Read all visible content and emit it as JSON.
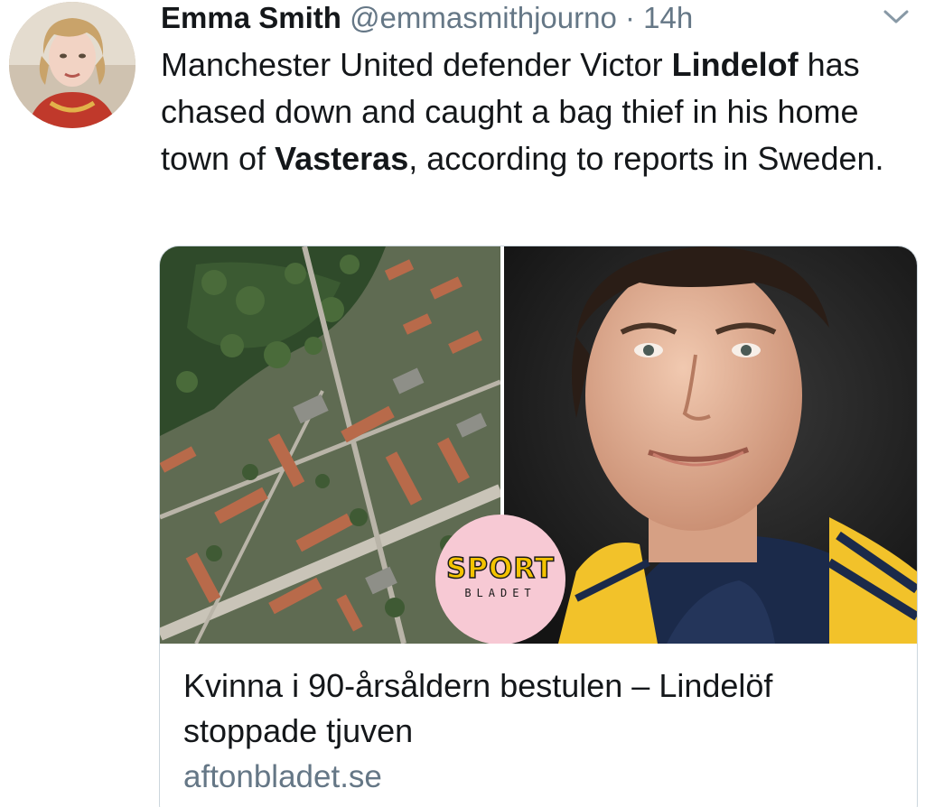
{
  "author": {
    "name": "Emma Smith",
    "handle": "@emmasmithjourno",
    "separator": "·",
    "time": "14h"
  },
  "tweet": {
    "segments": [
      {
        "text": "Manchester United defender Victor ",
        "bold": false
      },
      {
        "text": "Lindelof",
        "bold": true
      },
      {
        "text": " has chased down and caught a bag thief in his home town of ",
        "bold": false
      },
      {
        "text": "Vasteras",
        "bold": true
      },
      {
        "text": ", according to reports in Sweden.",
        "bold": false
      }
    ]
  },
  "card": {
    "logo": {
      "line1": "SPORT",
      "line2": "BLADET"
    },
    "title": "Kvinna i 90-årsåldern bestulen – Lindelöf stoppade tjuven",
    "domain": "aftonbladet.se"
  },
  "icons": {
    "menu": "chevron-down-icon"
  },
  "colors": {
    "text": "#14171a",
    "secondary": "#657786",
    "border": "#ccd6dd",
    "logo_bg": "#f7c9d4",
    "logo_yellow": "#f4c300"
  }
}
